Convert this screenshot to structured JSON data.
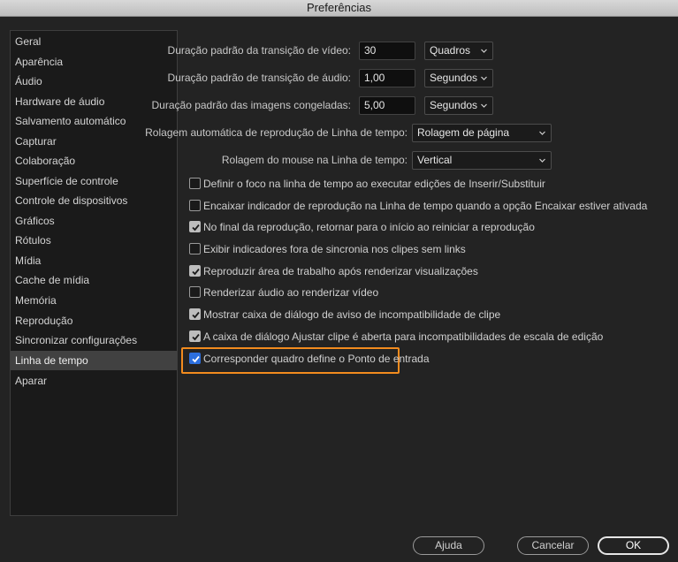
{
  "window": {
    "title": "Preferências"
  },
  "sidebar": {
    "items": [
      {
        "label": "Geral"
      },
      {
        "label": "Aparência"
      },
      {
        "label": "Áudio"
      },
      {
        "label": "Hardware de áudio"
      },
      {
        "label": "Salvamento automático"
      },
      {
        "label": "Capturar"
      },
      {
        "label": "Colaboração"
      },
      {
        "label": "Superfície de controle"
      },
      {
        "label": "Controle de dispositivos"
      },
      {
        "label": "Gráficos"
      },
      {
        "label": "Rótulos"
      },
      {
        "label": "Mídia"
      },
      {
        "label": "Cache de mídia"
      },
      {
        "label": "Memória"
      },
      {
        "label": "Reprodução"
      },
      {
        "label": "Sincronizar configurações"
      },
      {
        "label": "Linha de tempo"
      },
      {
        "label": "Aparar"
      }
    ],
    "selected_label": "Linha de tempo"
  },
  "settings": {
    "video_transition": {
      "label": "Duração padrão da transição de vídeo:",
      "value": "30",
      "unit": "Quadros"
    },
    "audio_transition": {
      "label": "Duração padrão de transição de áudio:",
      "value": "1,00",
      "unit": "Segundos"
    },
    "still_image": {
      "label": "Duração padrão das imagens congeladas:",
      "value": "5,00",
      "unit": "Segundos"
    },
    "auto_scroll": {
      "label": "Rolagem automática de reprodução de Linha de tempo:",
      "value": "Rolagem de página"
    },
    "mouse_scroll": {
      "label": "Rolagem do mouse na Linha de tempo:",
      "value": "Vertical"
    }
  },
  "checkboxes": [
    {
      "label": "Definir o foco na linha de tempo ao executar edições de Inserir/Substituir",
      "checked": false
    },
    {
      "label": "Encaixar indicador de reprodução na Linha de tempo quando a opção Encaixar estiver ativada",
      "checked": false
    },
    {
      "label": "No final da reprodução, retornar para o início ao reiniciar a reprodução",
      "checked": true
    },
    {
      "label": "Exibir indicadores fora de sincronia nos clipes sem links",
      "checked": false
    },
    {
      "label": "Reproduzir área de trabalho após renderizar visualizações",
      "checked": true
    },
    {
      "label": "Renderizar áudio ao renderizar vídeo",
      "checked": false
    },
    {
      "label": "Mostrar caixa de diálogo de aviso de incompatibilidade de clipe",
      "checked": true
    },
    {
      "label": "A caixa de diálogo Ajustar clipe é aberta para incompatibilidades de escala de edição",
      "checked": true
    },
    {
      "label": "Corresponder quadro define o Ponto de entrada",
      "checked": true
    }
  ],
  "buttons": {
    "help": "Ajuda",
    "cancel": "Cancelar",
    "ok": "OK"
  },
  "colors": {
    "highlight": "#f28b1e",
    "checkbox_active": "#2c6fde"
  }
}
